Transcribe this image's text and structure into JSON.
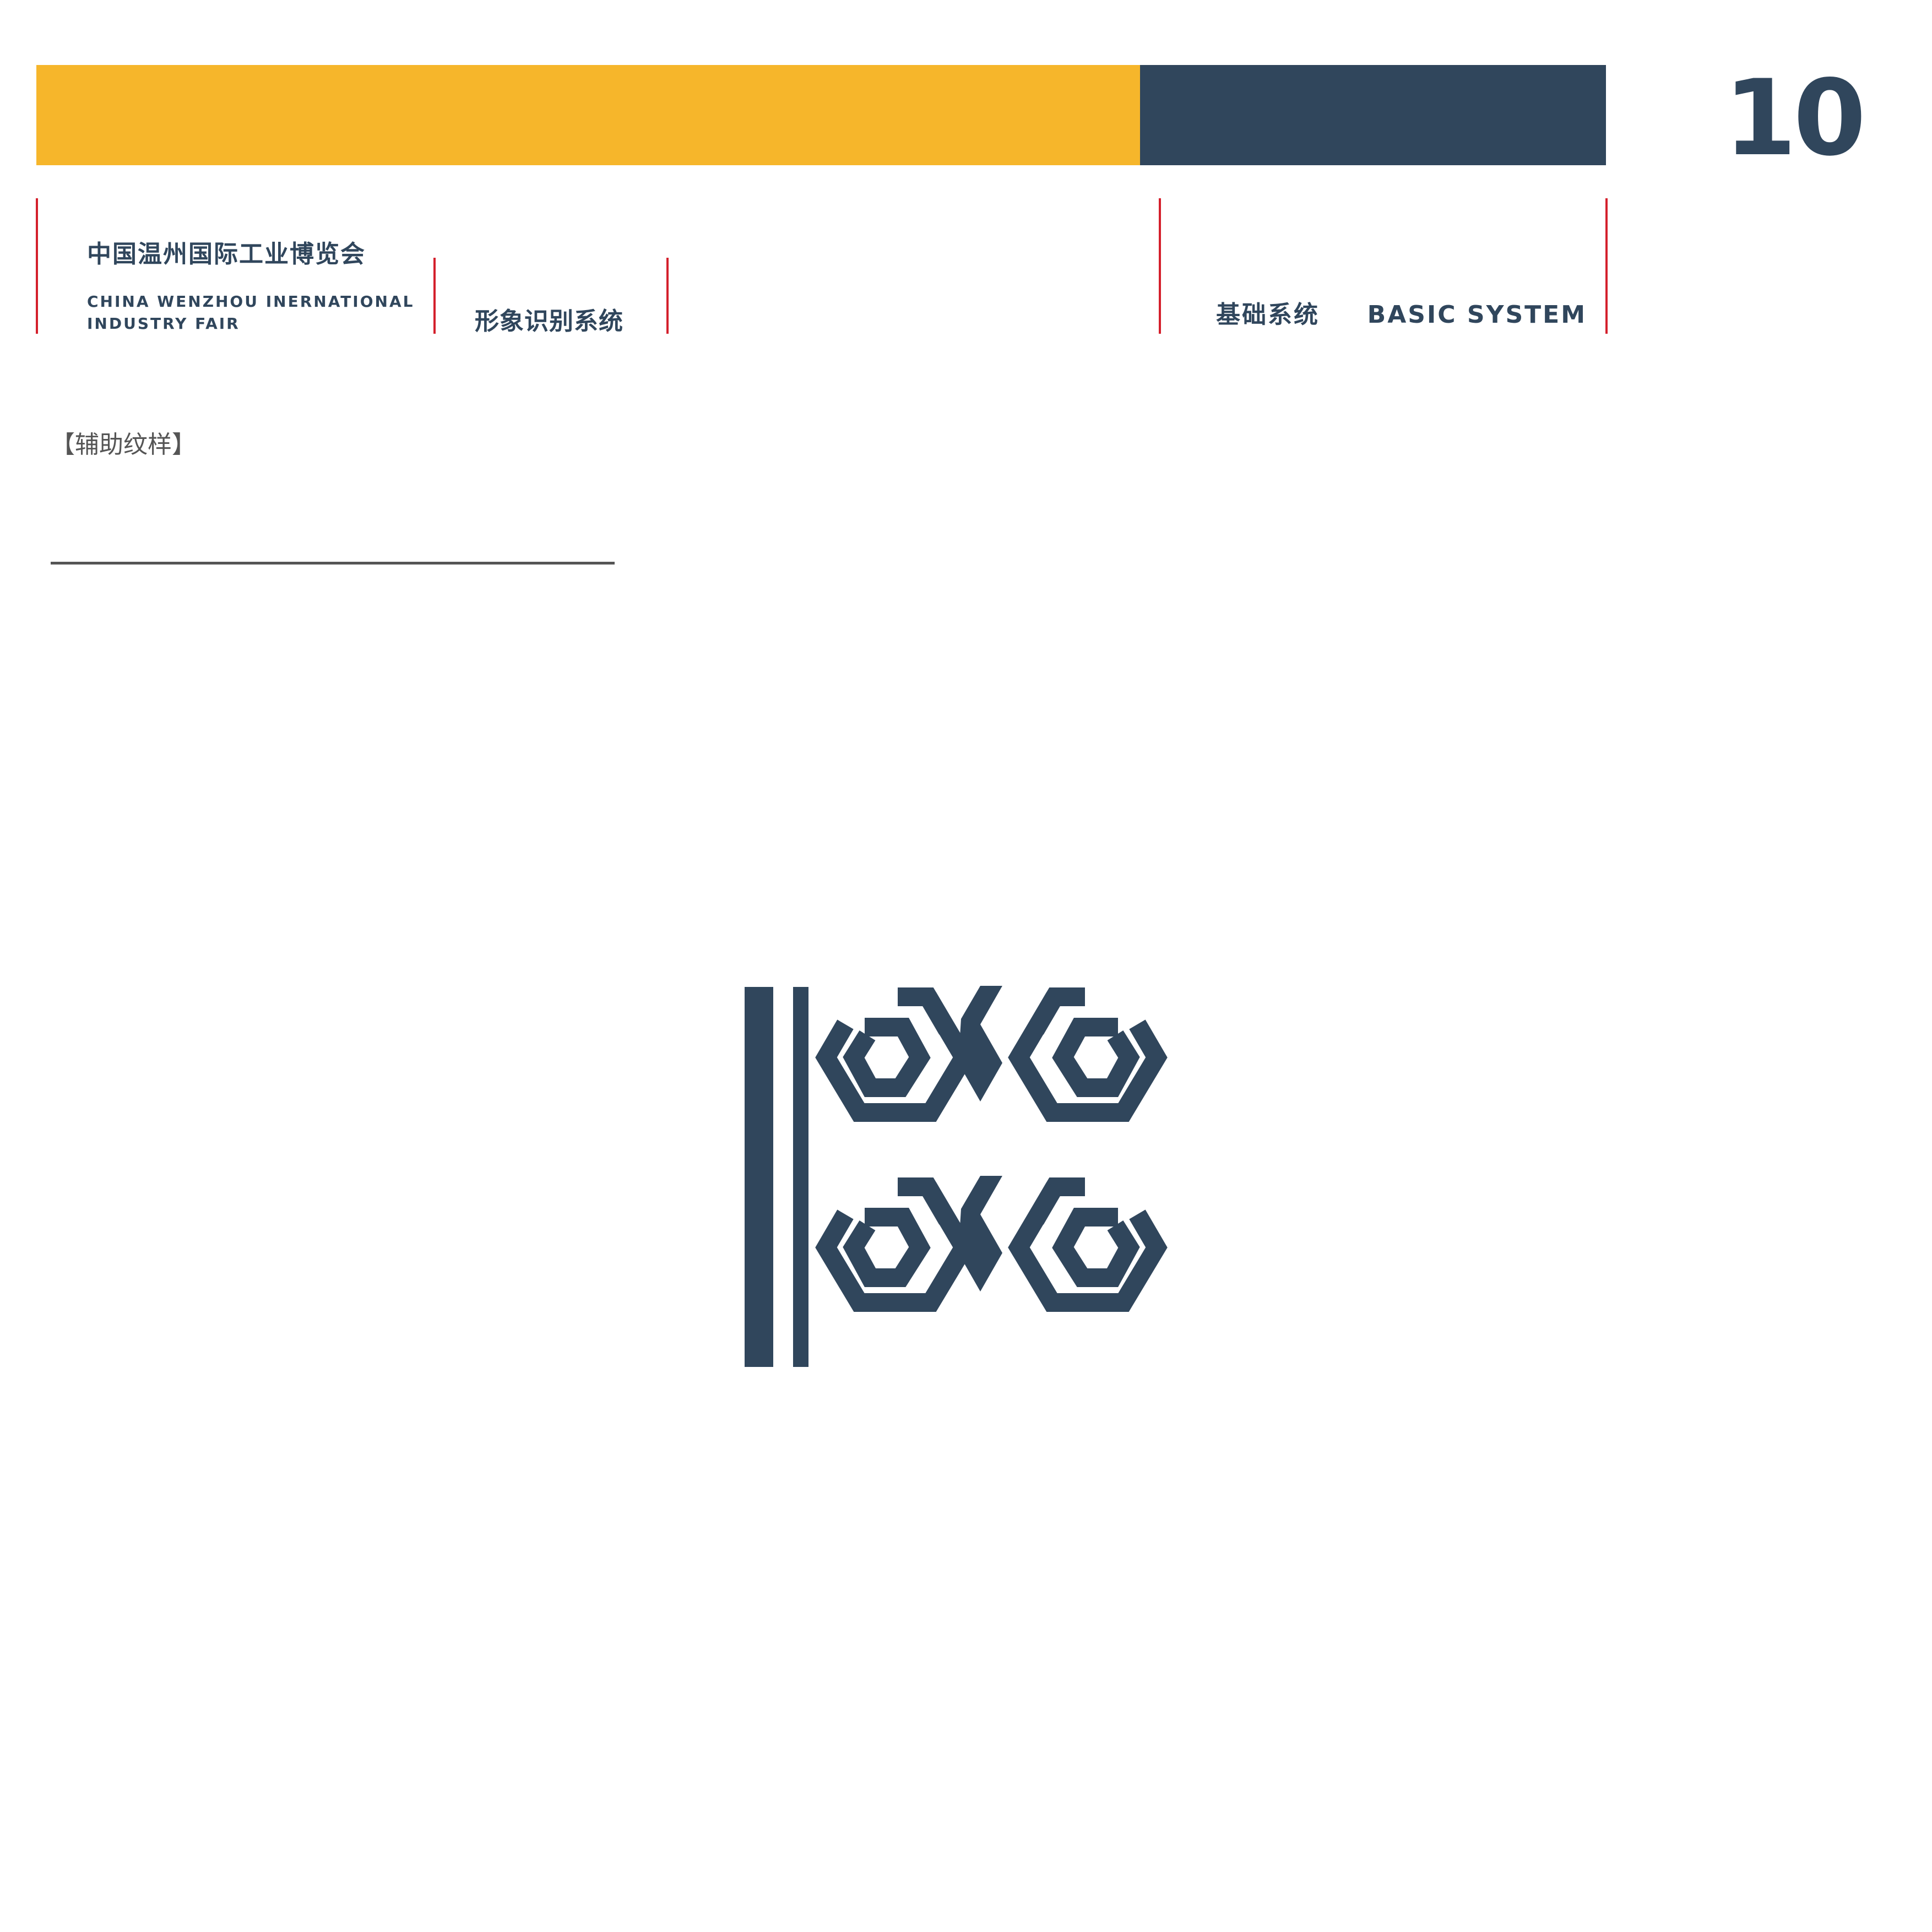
{
  "header": {
    "page_number": "10",
    "org_name_cn": "中国温州国际工业博览会",
    "org_name_en_line1": "CHINA WENZHOU  INERNATIONAL",
    "org_name_en_line2": "INDUSTRY FAIR",
    "section_cn": "形象识别系统",
    "system_cn": "基础系统",
    "system_en": "BASIC SYSTEM"
  },
  "content": {
    "subtitle": "【辅助纹样】"
  },
  "colors": {
    "accent_yellow": "#f6b62b",
    "brand_navy": "#30465c",
    "divider_red": "#d4202c",
    "rule_gray": "#555555"
  },
  "graphic": {
    "pattern_icon": "hexagon-spiral-pattern-icon"
  }
}
